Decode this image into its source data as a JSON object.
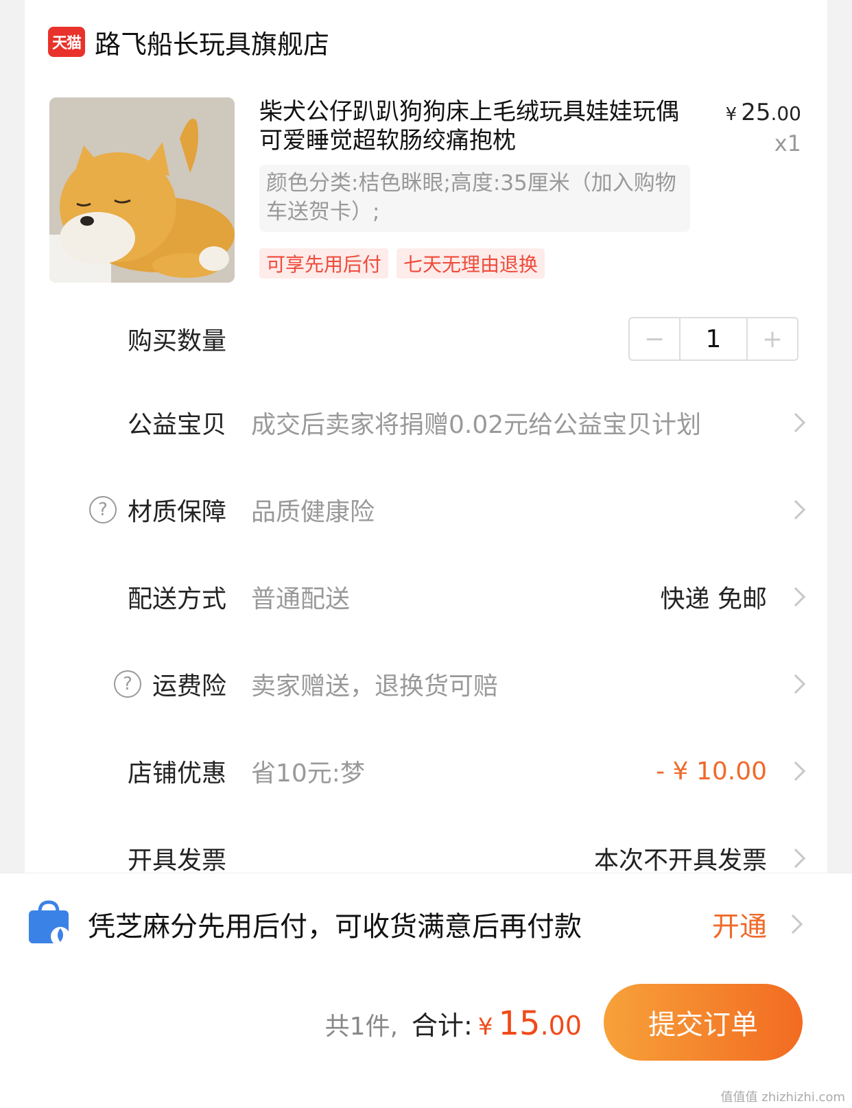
{
  "store": {
    "logo_text": "天猫",
    "name": "路飞船长玩具旗舰店"
  },
  "product": {
    "title": "柴犬公仔趴趴狗狗床上毛绒玩具娃娃玩偶可爱睡觉超软肠绞痛抱枕",
    "price_yen": "¥",
    "price_int": "25",
    "price_cents": ".00",
    "qty_label": "x1",
    "sku": "颜色分类:桔色眯眼;高度:35厘米（加入购物车送贺卡）;",
    "tags": [
      "可享先用后付",
      "七天无理由退换"
    ]
  },
  "rows": {
    "quantity": {
      "label": "购买数量",
      "value": "1",
      "minus": "−",
      "plus": "+"
    },
    "charity": {
      "label": "公益宝贝",
      "value": "成交后卖家将捐赠0.02元给公益宝贝计划"
    },
    "material": {
      "label": "材质保障",
      "value": "品质健康险"
    },
    "shipping": {
      "label": "配送方式",
      "value": "普通配送",
      "right": "快递 免邮"
    },
    "freight_ins": {
      "label": "运费险",
      "value": "卖家赠送，退换货可赔"
    },
    "discount": {
      "label": "店铺优惠",
      "value": "省10元:梦",
      "right": "- ¥ 10.00"
    },
    "invoice": {
      "label": "开具发票",
      "right": "本次不开具发票"
    }
  },
  "paylater": {
    "text": "凭芝麻分先用后付，可收货满意后再付款",
    "action": "开通"
  },
  "bottom": {
    "count": "共1件,",
    "total_label": "合计:",
    "total_yen": "¥",
    "total_int": "15",
    "total_cents": ".00",
    "submit": "提交订单"
  },
  "watermark": "值值值 zhizhizhi.com",
  "colors": {
    "accent": "#ef6a2a",
    "price_red": "#ef4a1a",
    "tmall_red": "#e8322b"
  }
}
